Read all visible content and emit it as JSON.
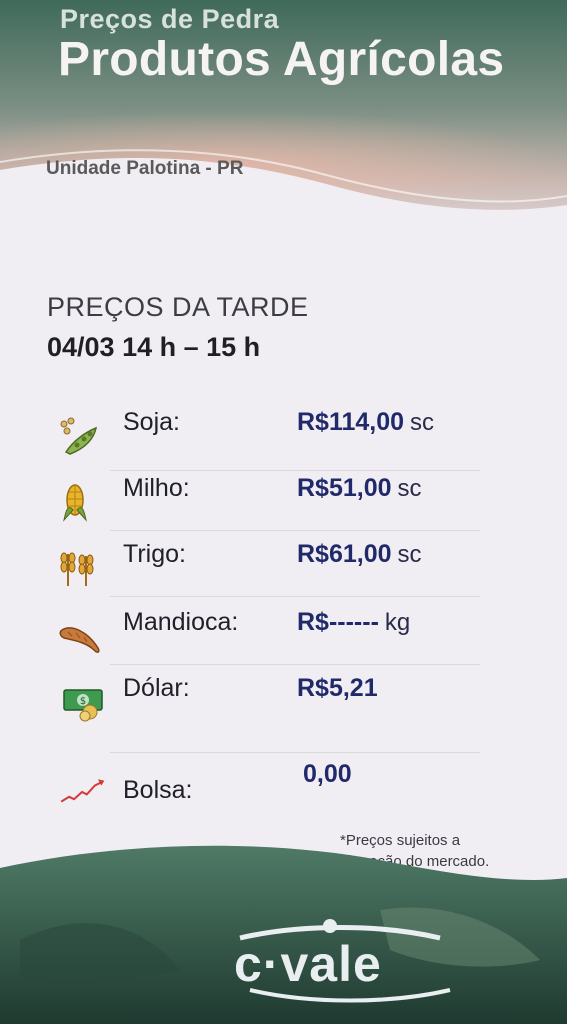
{
  "header": {
    "subtitle": "Preços de Pedra",
    "title": "Produtos Agrícolas",
    "unit": "Unidade Palotina - PR"
  },
  "board": {
    "period": "PREÇOS DA  TARDE",
    "datetime": "04/03  14 h – 15 h",
    "items": [
      {
        "icon": "soy-icon",
        "label": "Soja:",
        "price": "R$114,00",
        "unit": "sc"
      },
      {
        "icon": "corn-icon",
        "label": "Milho:",
        "price": "R$51,00",
        "unit": "sc"
      },
      {
        "icon": "wheat-icon",
        "label": "Trigo:",
        "price": "R$61,00",
        "unit": "sc"
      },
      {
        "icon": "cassava-icon",
        "label": "Mandioca:",
        "price": "R$------",
        "unit": "kg"
      },
      {
        "icon": "dollar-icon",
        "label": "Dólar:",
        "price": "R$5,21",
        "unit": ""
      },
      {
        "icon": "stock-chart-icon",
        "label": "Bolsa:",
        "price": "0,00",
        "unit": ""
      }
    ],
    "note_line1": "*Preços sujeitos a",
    "note_line2": "alteração do mercado."
  },
  "footer": {
    "logo": "c·vale"
  },
  "colors": {
    "price": "#202a6a",
    "header_green": "#3f6a5a",
    "footer_green": "#2e4a3d"
  }
}
